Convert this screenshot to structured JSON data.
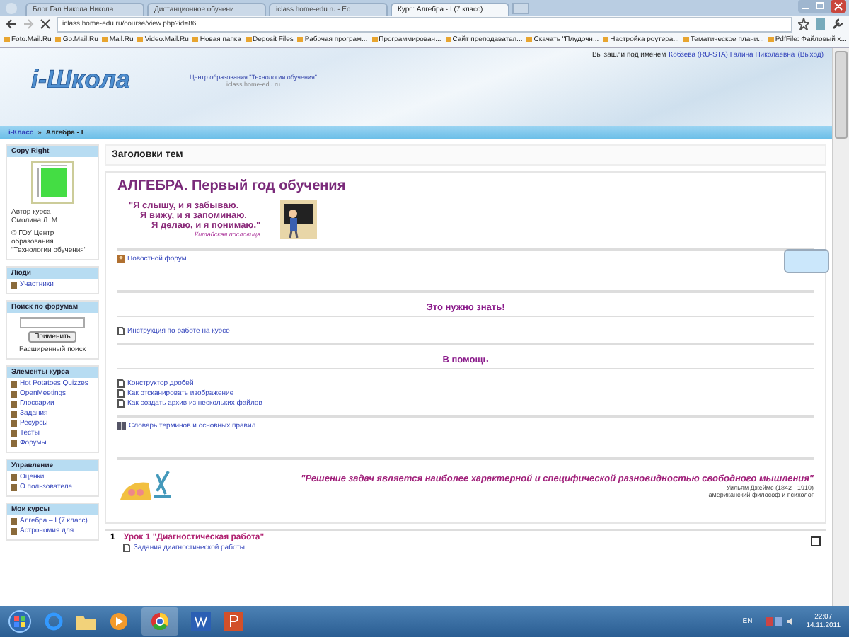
{
  "browser": {
    "tabs": [
      {
        "label": "Блог Гал.Никола Никола",
        "selected": false
      },
      {
        "label": "Дистанционное обучени",
        "selected": false
      },
      {
        "label": "iclass.home-edu.ru - Ed",
        "selected": false
      },
      {
        "label": "Курс: Алгебра - I (7 класс)",
        "selected": true
      }
    ],
    "address": "iclass.home-edu.ru/course/view.php?id=86",
    "bookmarks": [
      "Foto.Mail.Ru",
      "Go.Mail.Ru",
      "Mail.Ru",
      "Video.Mail.Ru",
      "Новая папка",
      "Deposit Files",
      "Рабочая програм...",
      "Программирован...",
      "Сайт преподавател...",
      "Скачать \"Плудочн...",
      "Настройка роутера...",
      "Тематическое плани...",
      "PdfFile: Файловый х..."
    ]
  },
  "page": {
    "login": {
      "prefix": "Вы зашли под именем",
      "user": "Кобзева (RU-STA) Галина Николаевна",
      "logout": "(Выход)"
    },
    "header": {
      "logo": "i-Школа",
      "org": "Центр образования \"Технологии обучения\"",
      "site": "iclass.home-edu.ru"
    },
    "breadcrumb": {
      "items": [
        "i-Класс",
        "Алгебра - I"
      ],
      "separator": "»"
    },
    "sidebar": [
      {
        "kind": "copyright",
        "title": "Copy Right",
        "author_label": "Автор курса",
        "author": "Смолина Л. М.",
        "copyright": "© ГОУ Центр образования \"Технологии обучения\""
      },
      {
        "kind": "links",
        "title": "Люди",
        "items": [
          "Участники"
        ]
      },
      {
        "kind": "search",
        "title": "Поиск по форумам",
        "button": "Применить",
        "advanced": "Расширенный поиск"
      },
      {
        "kind": "links",
        "title": "Элементы курса",
        "items": [
          "Hot Potatoes Quizzes",
          "OpenMeetings",
          "Глоссарии",
          "Задания",
          "Ресурсы",
          "Тесты",
          "Форумы"
        ]
      },
      {
        "kind": "links",
        "title": "Управление",
        "items": [
          "Оценки",
          "О пользователе"
        ]
      },
      {
        "kind": "links",
        "title": "Мои курсы",
        "items": [
          "Алгебра – I (7 класс)",
          "Астрономия для"
        ]
      }
    ],
    "main": {
      "heading": "Заголовки тем",
      "title": "АЛГЕБРА. Первый год обучения",
      "quote": {
        "lines": [
          "\"Я слышу, и я забываю.",
          "Я вижу, и я запоминаю.",
          "Я делаю, и я понимаю.\""
        ],
        "source": "Китайская пословица"
      },
      "groups": [
        [
          {
            "kind": "forum",
            "text": "Новостной форум"
          }
        ],
        [
          {
            "kind": "heading",
            "text": "Это нужно знать!"
          },
          {
            "kind": "resource",
            "text": "Инструкция по работе на курсе"
          }
        ],
        [
          {
            "kind": "heading",
            "text": "В помощь"
          },
          {
            "kind": "resource",
            "text": "Конструктор дробей"
          },
          {
            "kind": "resource",
            "text": "Как отсканировать изображение"
          },
          {
            "kind": "resource",
            "text": "Как создать архив из нескольких файлов"
          }
        ],
        [
          {
            "kind": "glossary",
            "text": "Словарь терминов и основных правил"
          }
        ]
      ],
      "motto": {
        "text": "\"Решение задач является наиболее характерной и специфической разновидностью свободного мышления\"",
        "author": "Уильям Джеймс (1842 - 1910)",
        "role": "американский философ и психолог"
      },
      "sections": [
        {
          "number": "1",
          "title": "Урок 1 \"Диагностическая работа\"",
          "items": [
            "Задания диагностической работы"
          ]
        }
      ]
    }
  },
  "taskbar": {
    "language": "EN",
    "time": "22:07",
    "date": "14.11.2011"
  }
}
